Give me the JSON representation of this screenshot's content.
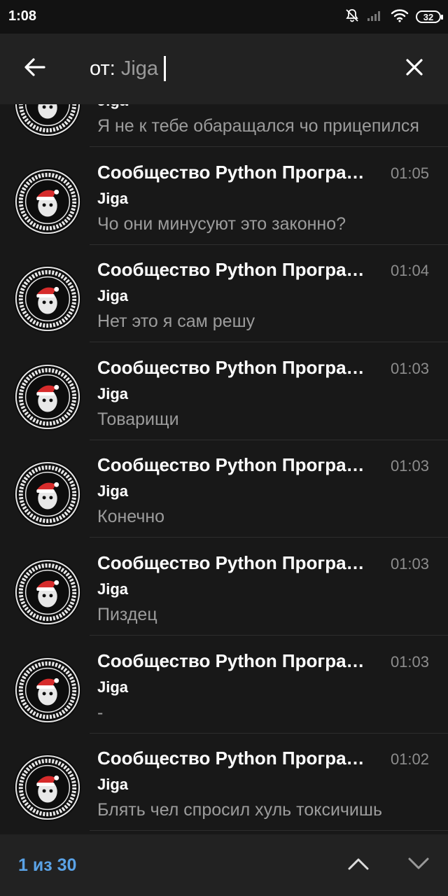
{
  "status": {
    "time": "1:08",
    "battery": "32",
    "icons": [
      "muted-bell-icon",
      "signal-icon",
      "wifi-icon",
      "battery-icon"
    ]
  },
  "search": {
    "prefix": "от:",
    "value": "Jiga",
    "back_icon": "arrow-left-icon",
    "close_icon": "close-icon"
  },
  "results": [
    {
      "title": "",
      "sender": "Jiga",
      "time": "",
      "message": "Я не к  тебе  обаращался чо прицепился"
    },
    {
      "title": "Сообщество Python Программистов",
      "sender": "Jiga",
      "time": "01:05",
      "message": "Чо они минусуют это законно?"
    },
    {
      "title": "Сообщество Python Программистов",
      "sender": "Jiga",
      "time": "01:04",
      "message": "Нет это я сам решу"
    },
    {
      "title": "Сообщество Python Программистов",
      "sender": "Jiga",
      "time": "01:03",
      "message": "Товарищи"
    },
    {
      "title": "Сообщество Python Программистов",
      "sender": "Jiga",
      "time": "01:03",
      "message": "Конечно"
    },
    {
      "title": "Сообщество Python Программистов",
      "sender": "Jiga",
      "time": "01:03",
      "message": "Пиздец"
    },
    {
      "title": "Сообщество Python Программистов",
      "sender": "Jiga",
      "time": "01:03",
      "message": "-"
    },
    {
      "title": "Сообщество Python Программистов",
      "sender": "Jiga",
      "time": "01:02",
      "message": "Блять чел спросил хуль токсичишь"
    }
  ],
  "bottom": {
    "counter": "1 из 30",
    "up_icon": "chevron-up-icon",
    "down_icon": "chevron-down-icon"
  },
  "colors": {
    "background": "#181818",
    "toolbar": "#222222",
    "accent": "#5aa2e6",
    "secondary_text": "#9c9c9c"
  }
}
